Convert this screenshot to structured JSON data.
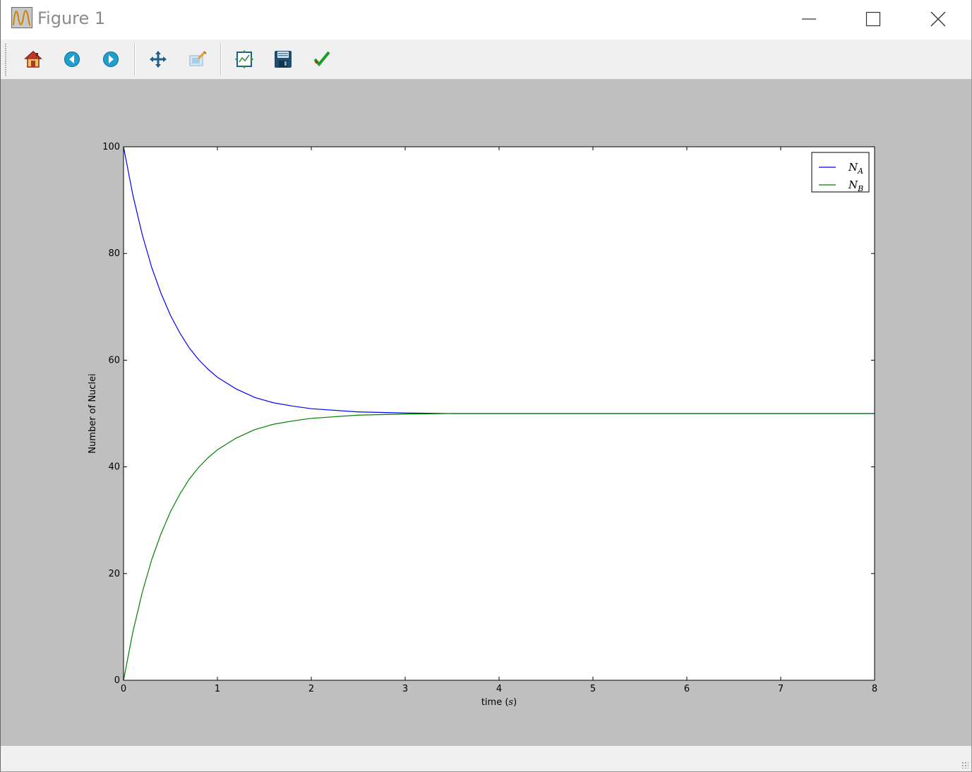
{
  "window": {
    "title": "Figure 1",
    "controls": [
      "minimize",
      "maximize",
      "close"
    ]
  },
  "toolbar": {
    "buttons": [
      {
        "name": "home-button",
        "icon": "home-icon"
      },
      {
        "name": "back-button",
        "icon": "arrow-left-icon"
      },
      {
        "name": "forward-button",
        "icon": "arrow-right-icon"
      },
      {
        "name": "pan-button",
        "icon": "move-arrows-icon"
      },
      {
        "name": "zoom-button",
        "icon": "zoom-rect-icon"
      },
      {
        "name": "subplots-button",
        "icon": "subplots-icon"
      },
      {
        "name": "save-button",
        "icon": "floppy-disk-icon"
      },
      {
        "name": "edit-axis-button",
        "icon": "checkmark-icon"
      }
    ]
  },
  "colors": {
    "canvas_bg": "#bfbfbf",
    "toolbar_bg": "#f0f0f0",
    "series_A": "#0000ff",
    "series_B": "#008000"
  },
  "chart_data": {
    "type": "line",
    "title": "",
    "xlabel_prefix": "time (",
    "xlabel_math": "s",
    "xlabel_suffix": ")",
    "ylabel": "Number of Nuclei",
    "xlim": [
      0,
      8
    ],
    "ylim": [
      0,
      100
    ],
    "xticks": [
      "0",
      "1",
      "2",
      "3",
      "4",
      "5",
      "6",
      "7",
      "8"
    ],
    "yticks": [
      "0",
      "20",
      "40",
      "60",
      "80",
      "100"
    ],
    "grid": false,
    "legend_position": "top-right",
    "series": [
      {
        "name_base": "N",
        "name_sub": "A",
        "color": "#0000ff",
        "x": [
          0,
          0.1,
          0.2,
          0.3,
          0.4,
          0.5,
          0.6,
          0.7,
          0.8,
          0.9,
          1.0,
          1.2,
          1.4,
          1.6,
          1.8,
          2.0,
          2.5,
          3.0,
          3.5,
          4.0,
          5.0,
          6.0,
          7.0,
          8.0
        ],
        "y": [
          100,
          90.9,
          83.5,
          77.4,
          72.5,
          68.4,
          65.1,
          62.3,
          60.1,
          58.3,
          56.8,
          54.6,
          53.0,
          52.0,
          51.4,
          50.9,
          50.3,
          50.1,
          50.0,
          50.0,
          50.0,
          50.0,
          50.0,
          50.0
        ]
      },
      {
        "name_base": "N",
        "name_sub": "B",
        "color": "#008000",
        "x": [
          0,
          0.1,
          0.2,
          0.3,
          0.4,
          0.5,
          0.6,
          0.7,
          0.8,
          0.9,
          1.0,
          1.2,
          1.4,
          1.6,
          1.8,
          2.0,
          2.5,
          3.0,
          3.5,
          4.0,
          5.0,
          6.0,
          7.0,
          8.0
        ],
        "y": [
          0,
          9.1,
          16.5,
          22.6,
          27.5,
          31.6,
          34.9,
          37.7,
          39.9,
          41.7,
          43.2,
          45.4,
          47.0,
          48.0,
          48.6,
          49.1,
          49.7,
          49.9,
          50.0,
          50.0,
          50.0,
          50.0,
          50.0,
          50.0
        ]
      }
    ]
  }
}
